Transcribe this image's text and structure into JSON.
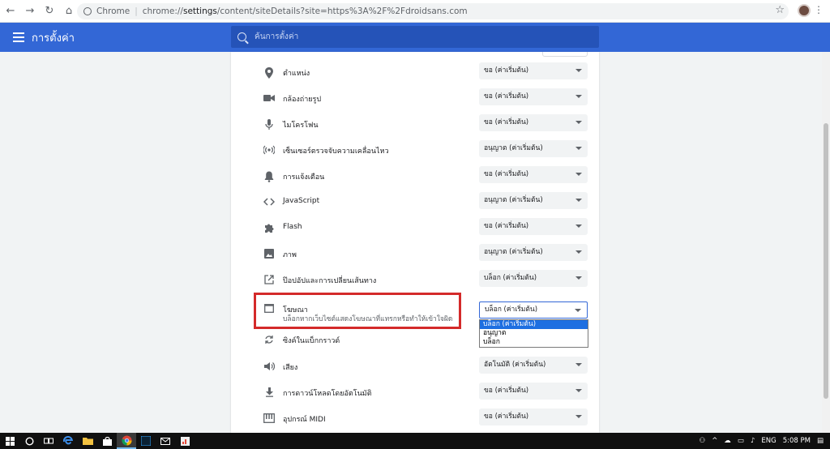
{
  "browser": {
    "chrome_label": "Chrome",
    "url_scheme": "chrome://",
    "url_host": "settings",
    "url_path": "/content/siteDetails?site=https%3A%2F%2Fdroidsans.com"
  },
  "header": {
    "title": "การตั้งค่า",
    "search_placeholder": "ค้นการตั้งค่า"
  },
  "permissions": [
    {
      "icon": "location-icon",
      "label": "ตำแหน่ง",
      "value": "ขอ (ค่าเริ่มต้น)"
    },
    {
      "icon": "camera-icon",
      "label": "กล้องถ่ายรูป",
      "value": "ขอ (ค่าเริ่มต้น)"
    },
    {
      "icon": "microphone-icon",
      "label": "ไมโครโฟน",
      "value": "ขอ (ค่าเริ่มต้น)"
    },
    {
      "icon": "motion-sensor-icon",
      "label": "เซ็นเซอร์ตรวจจับความเคลื่อนไหว",
      "value": "อนุญาต (ค่าเริ่มต้น)"
    },
    {
      "icon": "notification-bell-icon",
      "label": "การแจ้งเตือน",
      "value": "ขอ (ค่าเริ่มต้น)"
    },
    {
      "icon": "code-icon",
      "label": "JavaScript",
      "value": "อนุญาต (ค่าเริ่มต้น)"
    },
    {
      "icon": "puzzle-icon",
      "label": "Flash",
      "value": "ขอ (ค่าเริ่มต้น)"
    },
    {
      "icon": "image-icon",
      "label": "ภาพ",
      "value": "อนุญาต (ค่าเริ่มต้น)"
    },
    {
      "icon": "popup-icon",
      "label": "ป๊อปอัปและการเปลี่ยนเส้นทาง",
      "value": "บล็อก (ค่าเริ่มต้น)"
    },
    {
      "icon": "ads-icon",
      "label": "โฆษณา",
      "sublabel": "บล็อกหากเว็บไซต์แสดงโฆษณาที่แทรกหรือทำให้เข้าใจผิด",
      "value": "บล็อก (ค่าเริ่มต้น)"
    },
    {
      "icon": "sync-icon",
      "label": "ซิงค์ในแบ็กกราวด์",
      "value": ""
    },
    {
      "icon": "sound-icon",
      "label": "เสียง",
      "value": "อัตโนมัติ (ค่าเริ่มต้น)"
    },
    {
      "icon": "download-icon",
      "label": "การดาวน์โหลดโดยอัตโนมัติ",
      "value": "ขอ (ค่าเริ่มต้น)"
    },
    {
      "icon": "midi-icon",
      "label": "อุปกรณ์ MIDI",
      "value": "ขอ (ค่าเริ่มต้น)"
    }
  ],
  "ads_dropdown": {
    "options": [
      "บล็อก (ค่าเริ่มต้น)",
      "อนุญาต",
      "บล็อก"
    ],
    "selected_index": 0
  },
  "tray": {
    "language": "ENG",
    "time": "5:08 PM"
  },
  "colors": {
    "header": "#3367d6",
    "highlight_box": "#d42a2a",
    "dropdown_selected": "#1e6fe1"
  }
}
